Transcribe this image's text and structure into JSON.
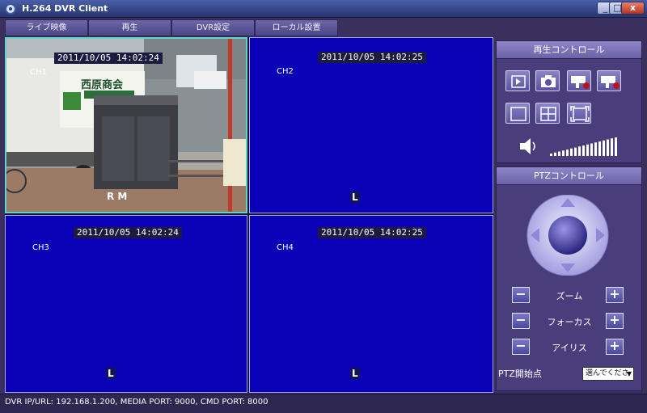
{
  "window": {
    "title": "H.264 DVR Client",
    "min_glyph": "_",
    "max_glyph": "□",
    "close_glyph": "x"
  },
  "tabs": [
    "ライブ映像",
    "再生",
    "DVR設定",
    "ローカル設置"
  ],
  "channels": [
    {
      "name": "CH1",
      "timestamp": "2011/10/05 14:02:24",
      "status": "R M"
    },
    {
      "name": "CH2",
      "timestamp": "2011/10/05 14:02:25",
      "status": "L"
    },
    {
      "name": "CH3",
      "timestamp": "2011/10/05 14:02:24",
      "status": "L"
    },
    {
      "name": "CH4",
      "timestamp": "2011/10/05 14:02:25",
      "status": "L"
    }
  ],
  "ch1_scene": {
    "sign_text": "西原商会"
  },
  "playback_panel": {
    "title": "再生コントロール",
    "buttons": [
      "play-icon",
      "snapshot-icon",
      "record-icon",
      "record-all-icon",
      "single-view-icon",
      "quad-view-icon",
      "fullscreen-icon"
    ],
    "volume_icon": "speaker-icon",
    "volume_level": 1.0
  },
  "ptz_panel": {
    "title": "PTZコントロール",
    "rows": [
      {
        "label": "ズーム",
        "minus": "−",
        "plus": "+"
      },
      {
        "label": "フォーカス",
        "minus": "−",
        "plus": "+"
      },
      {
        "label": "アイリス",
        "minus": "−",
        "plus": "+"
      }
    ],
    "start_label": "PTZ開始点",
    "start_select": "選んでくださ"
  },
  "statusbar": "DVR IP/URL: 192.168.1.200, MEDIA PORT: 9000, CMD PORT: 8000",
  "colors": {
    "video_bg": "#0a00b8",
    "panel_bg": "#4a3d7c",
    "active_border": "#5fd5c8"
  }
}
